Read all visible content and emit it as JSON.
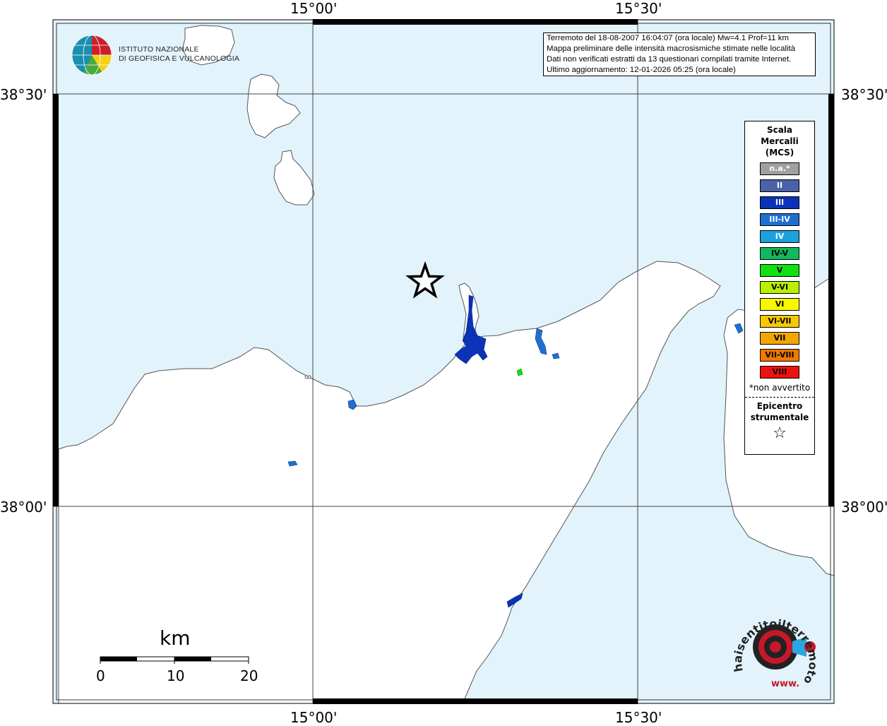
{
  "map": {
    "coords": {
      "lon_15_00_top": "15°00'",
      "lon_15_30_top": "15°30'",
      "lon_15_00_bottom": "15°00'",
      "lon_15_30_bottom": "15°30'",
      "lat_38_30_left": "38°30'",
      "lat_38_30_right": "38°30'",
      "lat_38_00_left": "38°00'",
      "lat_38_00_right": "38°00'"
    },
    "colors": {
      "sea": "#e2f3fc",
      "land": "#ffffff",
      "coast": "#555555"
    }
  },
  "logo": {
    "line1": "ISTITUTO NAZIONALE",
    "line2": "DI GEOFISICA E VULCANOLOGIA",
    "icon": "ingv-globe-icon"
  },
  "info": {
    "line1": "Terremoto del 18-08-2007 16:04:07 (ora locale) Mw=4.1 Prof=11 km",
    "line2": "Mappa preliminare delle intensità macrosismiche stimate nelle località",
    "line3": "Dati non verificati estratti da 13 questionari compilati tramite Internet.",
    "line4": "Ultimo aggiornamento: 12-01-2026 05:25 (ora locale)"
  },
  "legend": {
    "title1": "Scala",
    "title2": "Mercalli",
    "title3": "(MCS)",
    "items": [
      {
        "label": "n.a.*",
        "color": "#a0a0a0"
      },
      {
        "label": "II",
        "color": "#4b62a8"
      },
      {
        "label": "III",
        "color": "#0a33b8"
      },
      {
        "label": "III-IV",
        "color": "#1f6fd0"
      },
      {
        "label": "IV",
        "color": "#1ba2dc"
      },
      {
        "label": "IV-V",
        "color": "#12b85e"
      },
      {
        "label": "V",
        "color": "#11e011"
      },
      {
        "label": "V-VI",
        "color": "#b8f000"
      },
      {
        "label": "VI",
        "color": "#f7f700"
      },
      {
        "label": "VI-VII",
        "color": "#f7c800"
      },
      {
        "label": "VII",
        "color": "#f5a500"
      },
      {
        "label": "VII-VIII",
        "color": "#f07800"
      },
      {
        "label": "VIII",
        "color": "#ee1111"
      }
    ],
    "note": "*non avvertito",
    "epi1": "Epicentro",
    "epi2": "strumentale",
    "star": "☆"
  },
  "scale": {
    "unit": "km",
    "label0": "0",
    "label10": "10",
    "label20": "20"
  },
  "brand": {
    "text": "haisentitoilterremoto.it",
    "www": "www.",
    "icon": "haisentito-target-icon"
  }
}
